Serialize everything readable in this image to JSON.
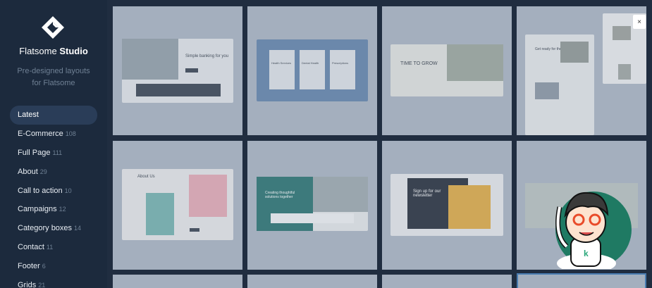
{
  "sidebar": {
    "brand_light": "Flatsome",
    "brand_bold": "Studio",
    "tagline_line1": "Pre-designed layouts",
    "tagline_line2": "for Flatsome",
    "items": [
      {
        "label": "Latest",
        "count": ""
      },
      {
        "label": "E-Commerce",
        "count": "108"
      },
      {
        "label": "Full Page",
        "count": "111"
      },
      {
        "label": "About",
        "count": "29"
      },
      {
        "label": "Call to action",
        "count": "10"
      },
      {
        "label": "Campaigns",
        "count": "12"
      },
      {
        "label": "Category boxes",
        "count": "14"
      },
      {
        "label": "Contact",
        "count": "11"
      },
      {
        "label": "Footer",
        "count": "6"
      },
      {
        "label": "Grids",
        "count": "21"
      }
    ]
  },
  "close_label": "×",
  "thumbs": {
    "t1_heading": "Simple banking for you",
    "t3_heading": "TIME TO GROW",
    "t4_heading": "Get ready for the market",
    "t5_heading": "About Us",
    "t6_heading": "Creating thoughtful solutions together",
    "t7_heading": "Sign up for our newsletter",
    "t2_box1": "Health Services",
    "t2_box2": "Dental Health",
    "t2_box3": "Prescriptions"
  },
  "colors": {
    "sidebar_bg": "#1c2a3d",
    "active_item": "#2a3d58",
    "accent": "#2f6fb0"
  }
}
